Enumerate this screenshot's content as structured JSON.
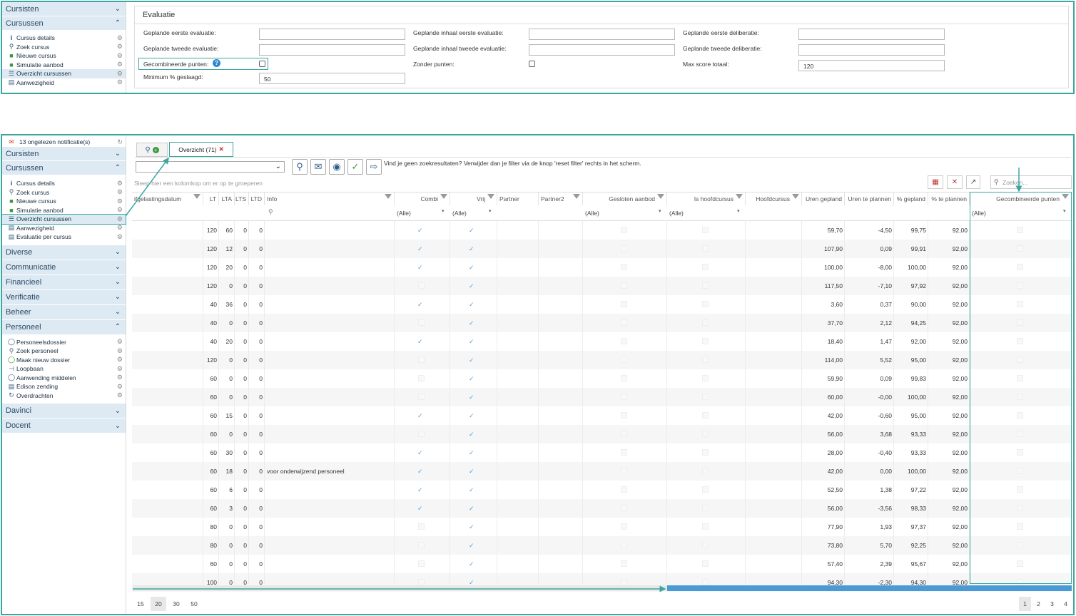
{
  "top_sidebar": {
    "sections": [
      {
        "label": "Cursisten",
        "expanded": false
      },
      {
        "label": "Cursussen",
        "expanded": true
      }
    ],
    "items": [
      {
        "label": "Cursus details",
        "icon": "info-icon"
      },
      {
        "label": "Zoek cursus",
        "icon": "search-icon"
      },
      {
        "label": "Nieuwe cursus",
        "icon": "folder-add-icon"
      },
      {
        "label": "Simulatie aanbod",
        "icon": "folder-play-icon"
      },
      {
        "label": "Overzicht cursussen",
        "icon": "list-icon"
      },
      {
        "label": "Aanwezigheid",
        "icon": "document-icon"
      }
    ]
  },
  "evaluatie": {
    "title": "Evaluatie",
    "fields": {
      "geplande_eerste_evaluatie": {
        "label": "Geplande eerste evaluatie:",
        "value": ""
      },
      "geplande_tweede_evaluatie": {
        "label": "Geplande tweede evaluatie:",
        "value": ""
      },
      "gecombineerde_punten": {
        "label": "Gecombineerde punten:",
        "checked": false
      },
      "minimum_geslaagd": {
        "label": "Minimum % geslaagd:",
        "value": "50"
      },
      "inhaal_eerste": {
        "label": "Geplande inhaal eerste evaluatie:",
        "value": ""
      },
      "inhaal_tweede": {
        "label": "Geplande inhaal tweede evaluatie:",
        "value": ""
      },
      "zonder_punten": {
        "label": "Zonder punten:",
        "checked": false
      },
      "eerste_deliberatie": {
        "label": "Geplande eerste deliberatie:",
        "value": ""
      },
      "tweede_deliberatie": {
        "label": "Geplande tweede deliberatie:",
        "value": ""
      },
      "max_score": {
        "label": "Max score totaal:",
        "value": "120"
      }
    }
  },
  "bottom_sidebar": {
    "notifications": "13 ongelezen notificatie(s)",
    "sections": [
      {
        "label": "Cursisten"
      },
      {
        "label": "Cursussen"
      },
      {
        "label": "Diverse"
      },
      {
        "label": "Communicatie"
      },
      {
        "label": "Financieel"
      },
      {
        "label": "Verificatie"
      },
      {
        "label": "Beheer"
      },
      {
        "label": "Personeel"
      },
      {
        "label": "Davinci"
      },
      {
        "label": "Docent"
      }
    ],
    "cursussen_items": [
      {
        "label": "Cursus details",
        "icon": "info-icon"
      },
      {
        "label": "Zoek cursus",
        "icon": "search-icon"
      },
      {
        "label": "Nieuwe cursus",
        "icon": "folder-add-icon"
      },
      {
        "label": "Simulatie aanbod",
        "icon": "folder-play-icon"
      },
      {
        "label": "Overzicht cursussen",
        "icon": "list-icon"
      },
      {
        "label": "Aanwezigheid",
        "icon": "document-icon"
      },
      {
        "label": "Evaluatie per cursus",
        "icon": "document-icon"
      }
    ],
    "personeel_items": [
      {
        "label": "Personeelsdossier",
        "icon": "person-icon"
      },
      {
        "label": "Zoek personeel",
        "icon": "search-icon"
      },
      {
        "label": "Maak nieuw dossier",
        "icon": "person-add-icon"
      },
      {
        "label": "Loopbaan",
        "icon": "tree-icon"
      },
      {
        "label": "Aanwending middelen",
        "icon": "person-icon"
      },
      {
        "label": "Edison zending",
        "icon": "document-icon"
      },
      {
        "label": "Overdrachten",
        "icon": "refresh-icon"
      }
    ]
  },
  "tabs": {
    "search_tab": "",
    "overview_tab": "Overzicht (71)"
  },
  "toolbar": {
    "message": "Vind je geen zoekresultaten? Verwijder dan je filter via de knop 'reset filter' rechts in het scherm.",
    "group_hint": "Sleep hier een kolomkop om er op te groeperen",
    "search_placeholder": "Zoeken..."
  },
  "grid": {
    "columns": [
      "ifgelastingsdatum",
      "LT",
      "LTA",
      "LTS",
      "LTD",
      "Info",
      "Combi",
      "Vrij",
      "Partner",
      "Partner2",
      "Gesloten aanbod",
      "Is hoofdcursus",
      "Hoofdcursus",
      "Uren gepland",
      "Uren te plannen",
      "% gepland",
      "% te plannen",
      "Gecombineerde punten"
    ],
    "filter_all": "(Alle)",
    "rows": [
      {
        "lt": "120",
        "lta": "60",
        "lts": "0",
        "ltd": "0",
        "info": "",
        "combi": true,
        "vrij": true,
        "uren": "59,70",
        "te": "-4,50",
        "pg": "99,75",
        "ptp": "92,00"
      },
      {
        "lt": "120",
        "lta": "12",
        "lts": "0",
        "ltd": "0",
        "info": "",
        "combi": true,
        "vrij": true,
        "uren": "107,90",
        "te": "0,09",
        "pg": "99,91",
        "ptp": "92,00"
      },
      {
        "lt": "120",
        "lta": "20",
        "lts": "0",
        "ltd": "0",
        "info": "",
        "combi": true,
        "vrij": true,
        "uren": "100,00",
        "te": "-8,00",
        "pg": "100,00",
        "ptp": "92,00"
      },
      {
        "lt": "120",
        "lta": "0",
        "lts": "0",
        "ltd": "0",
        "info": "",
        "combi": false,
        "vrij": true,
        "uren": "117,50",
        "te": "-7,10",
        "pg": "97,92",
        "ptp": "92,00"
      },
      {
        "lt": "40",
        "lta": "36",
        "lts": "0",
        "ltd": "0",
        "info": "",
        "combi": true,
        "vrij": true,
        "uren": "3,60",
        "te": "0,37",
        "pg": "90,00",
        "ptp": "92,00"
      },
      {
        "lt": "40",
        "lta": "0",
        "lts": "0",
        "ltd": "0",
        "info": "",
        "combi": false,
        "vrij": true,
        "uren": "37,70",
        "te": "2,12",
        "pg": "94,25",
        "ptp": "92,00"
      },
      {
        "lt": "40",
        "lta": "20",
        "lts": "0",
        "ltd": "0",
        "info": "",
        "combi": true,
        "vrij": true,
        "uren": "18,40",
        "te": "1,47",
        "pg": "92,00",
        "ptp": "92,00"
      },
      {
        "lt": "120",
        "lta": "0",
        "lts": "0",
        "ltd": "0",
        "info": "",
        "combi": false,
        "vrij": true,
        "uren": "114,00",
        "te": "5,52",
        "pg": "95,00",
        "ptp": "92,00"
      },
      {
        "lt": "60",
        "lta": "0",
        "lts": "0",
        "ltd": "0",
        "info": "",
        "combi": false,
        "vrij": true,
        "uren": "59,90",
        "te": "0,09",
        "pg": "99,83",
        "ptp": "92,00"
      },
      {
        "lt": "60",
        "lta": "0",
        "lts": "0",
        "ltd": "0",
        "info": "",
        "combi": false,
        "vrij": true,
        "uren": "60,00",
        "te": "-0,00",
        "pg": "100,00",
        "ptp": "92,00"
      },
      {
        "lt": "60",
        "lta": "15",
        "lts": "0",
        "ltd": "0",
        "info": "",
        "combi": true,
        "vrij": true,
        "uren": "42,00",
        "te": "-0,60",
        "pg": "95,00",
        "ptp": "92,00"
      },
      {
        "lt": "60",
        "lta": "0",
        "lts": "0",
        "ltd": "0",
        "info": "",
        "combi": false,
        "vrij": true,
        "uren": "56,00",
        "te": "3,68",
        "pg": "93,33",
        "ptp": "92,00"
      },
      {
        "lt": "60",
        "lta": "30",
        "lts": "0",
        "ltd": "0",
        "info": "",
        "combi": true,
        "vrij": true,
        "uren": "28,00",
        "te": "-0,40",
        "pg": "93,33",
        "ptp": "92,00"
      },
      {
        "lt": "60",
        "lta": "18",
        "lts": "0",
        "ltd": "0",
        "info": "voor onderwijzend personeel",
        "combi": true,
        "vrij": true,
        "uren": "42,00",
        "te": "0,00",
        "pg": "100,00",
        "ptp": "92,00"
      },
      {
        "lt": "60",
        "lta": "6",
        "lts": "0",
        "ltd": "0",
        "info": "",
        "combi": true,
        "vrij": true,
        "uren": "52,50",
        "te": "1,38",
        "pg": "97,22",
        "ptp": "92,00"
      },
      {
        "lt": "60",
        "lta": "3",
        "lts": "0",
        "ltd": "0",
        "info": "",
        "combi": true,
        "vrij": true,
        "uren": "56,00",
        "te": "-3,56",
        "pg": "98,33",
        "ptp": "92,00"
      },
      {
        "lt": "80",
        "lta": "0",
        "lts": "0",
        "ltd": "0",
        "info": "",
        "combi": false,
        "vrij": true,
        "uren": "77,90",
        "te": "1,93",
        "pg": "97,37",
        "ptp": "92,00"
      },
      {
        "lt": "80",
        "lta": "0",
        "lts": "0",
        "ltd": "0",
        "info": "",
        "combi": false,
        "vrij": true,
        "uren": "73,80",
        "te": "5,70",
        "pg": "92,25",
        "ptp": "92,00"
      },
      {
        "lt": "60",
        "lta": "0",
        "lts": "0",
        "ltd": "0",
        "info": "",
        "combi": false,
        "vrij": true,
        "uren": "57,40",
        "te": "2,39",
        "pg": "95,67",
        "ptp": "92,00"
      },
      {
        "lt": "100",
        "lta": "0",
        "lts": "0",
        "ltd": "0",
        "info": "",
        "combi": false,
        "vrij": true,
        "uren": "94,30",
        "te": "-2,30",
        "pg": "94,30",
        "ptp": "92,00"
      }
    ]
  },
  "pager": {
    "sizes": [
      "15",
      "20",
      "30",
      "50"
    ],
    "selected_size": "20",
    "pages": [
      "1",
      "2",
      "3",
      "4"
    ],
    "current_page": "1"
  },
  "colors": {
    "accent": "#3aa8a0",
    "section_bg": "#dde9f3",
    "check": "#5aa0d6"
  }
}
